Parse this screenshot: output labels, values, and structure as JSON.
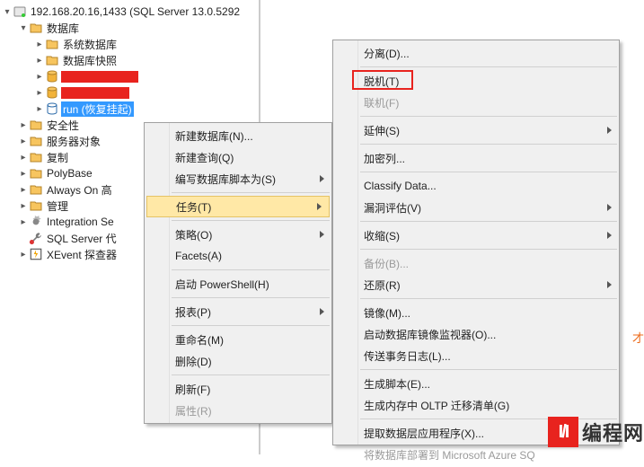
{
  "tree": {
    "server": "192.168.20.16,1433 (SQL Server 13.0.5292",
    "databases": "数据库",
    "sysdb": "系统数据库",
    "dbsnapshots": "数据库快照",
    "selectedDb": "run (恢复挂起)",
    "security": "安全性",
    "serverObjects": "服务器对象",
    "replication": "复制",
    "polybase": "PolyBase",
    "alwaysOn": "Always On 高",
    "management": "管理",
    "integrationSvc": "Integration Se",
    "sqlAgent": "SQL Server 代",
    "xevent": "XEvent 探查器"
  },
  "menu1": {
    "newDb": "新建数据库(N)...",
    "newQuery": "新建查询(Q)",
    "scriptDb": "编写数据库脚本为(S)",
    "tasks": "任务(T)",
    "policies": "策略(O)",
    "facets": "Facets(A)",
    "startPS": "启动 PowerShell(H)",
    "reports": "报表(P)",
    "rename": "重命名(M)",
    "delete": "删除(D)",
    "refresh": "刷新(F)",
    "properties": "属性(R)"
  },
  "menu2": {
    "detach": "分离(D)...",
    "offline": "脱机(T)",
    "online": "联机(F)",
    "stretch": "延伸(S)",
    "encrypt": "加密列...",
    "classify": "Classify Data...",
    "vuln": "漏洞评估(V)",
    "shrink": "收缩(S)",
    "backup": "备份(B)...",
    "restore": "还原(R)",
    "mirror": "镜像(M)...",
    "startMirror": "启动数据库镜像监视器(O)...",
    "shipLogs": "传送事务日志(L)...",
    "genScript": "生成脚本(E)...",
    "genOltp": "生成内存中 OLTP 迁移清单(G)",
    "extractDac": "提取数据层应用程序(X)...",
    "deployAzure": "将数据库部署到 Microsoft Azure SQ"
  },
  "misc": {
    "brand": "编程网",
    "brandIcon": "I/I",
    "orangeFrag": "才"
  }
}
